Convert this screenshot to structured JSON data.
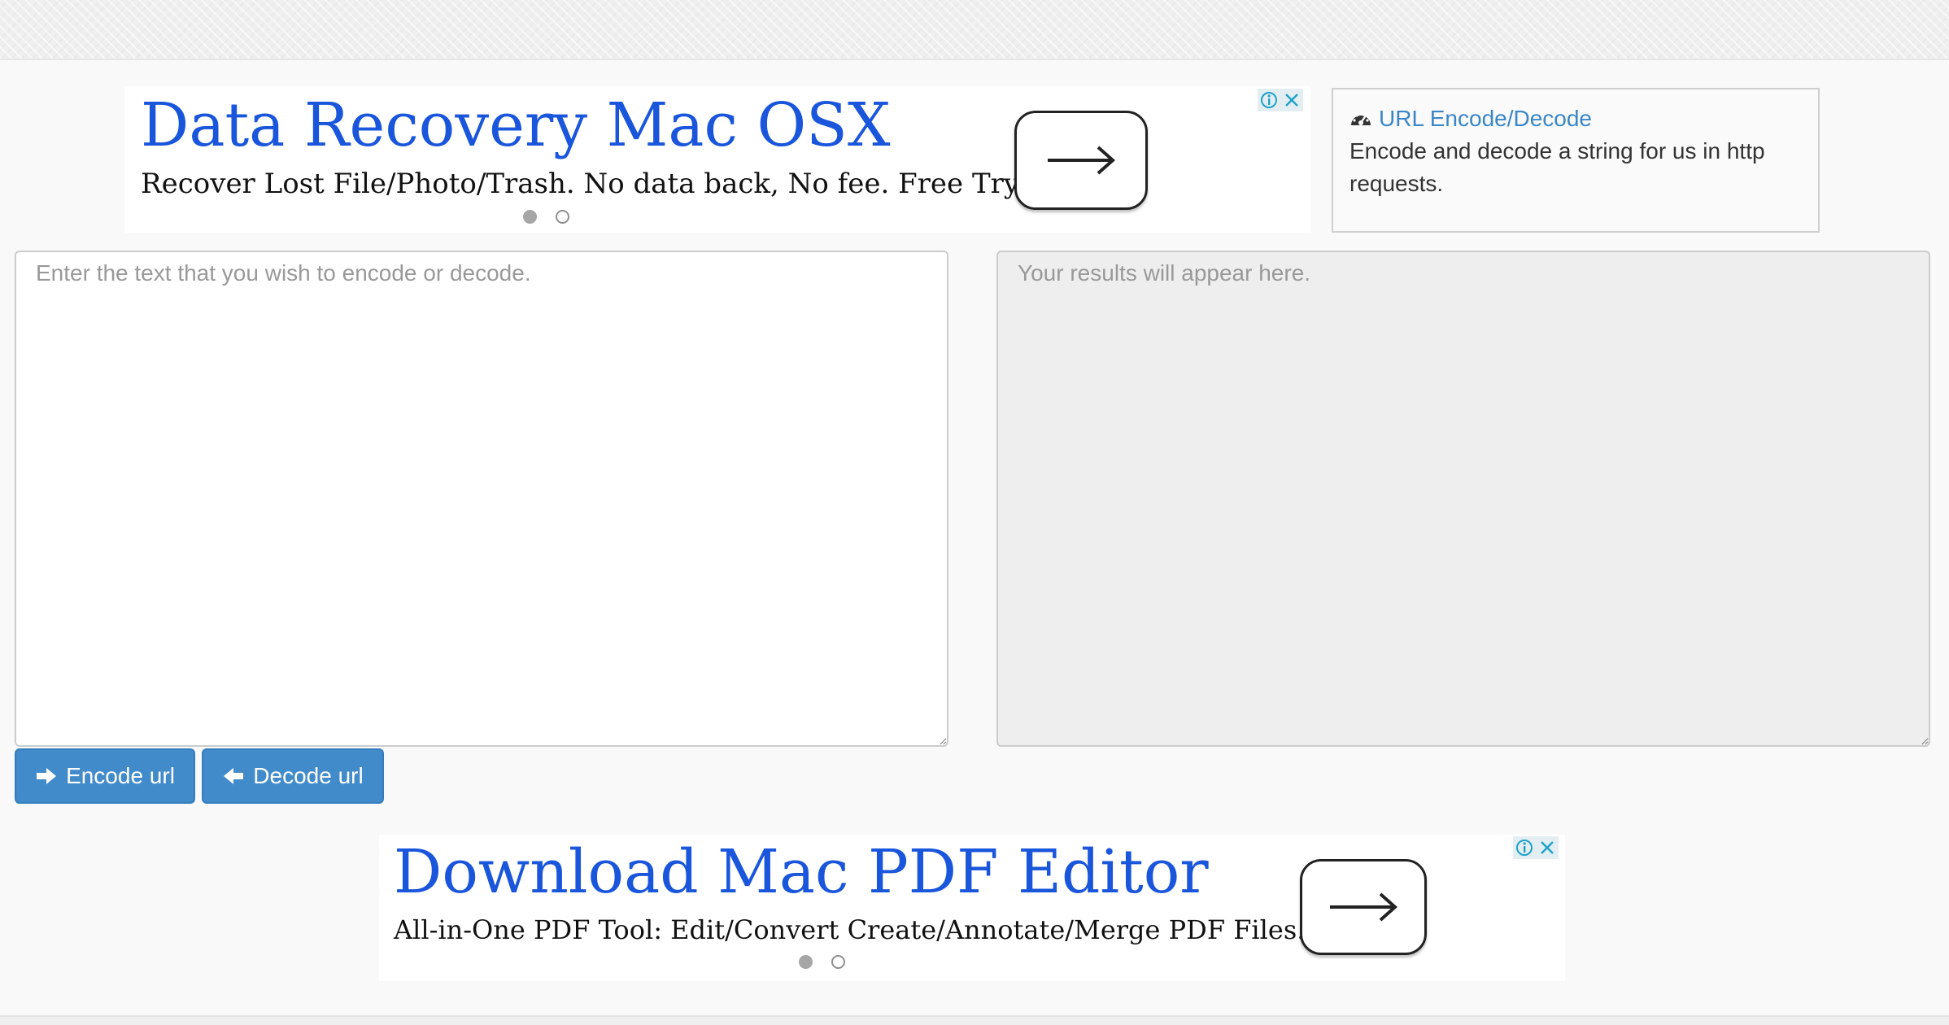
{
  "ad_top": {
    "title": "Data Recovery Mac OSX",
    "description": "Recover Lost File/Photo/Trash. No data back, No fee. Free Try!",
    "arrow_icon": "arrow-right-icon",
    "carousel_active": 1,
    "carousel_count": 2
  },
  "ad_bottom": {
    "title": "Download Mac PDF Editor",
    "description": "All-in-One PDF Tool: Edit/Convert Create/Annotate/Merge PDF Files.",
    "arrow_icon": "arrow-right-icon",
    "carousel_active": 1,
    "carousel_count": 2
  },
  "info_box": {
    "icon": "dashboard-icon",
    "title": "URL Encode/Decode",
    "description": "Encode and decode a string for us in http requests."
  },
  "input": {
    "placeholder": "Enter the text that you wish to encode or decode.",
    "value": ""
  },
  "output": {
    "placeholder": "Your results will appear here.",
    "value": ""
  },
  "buttons": {
    "encode_label": "Encode url",
    "encode_icon": "arrow-right-icon",
    "decode_label": "Decode url",
    "decode_icon": "arrow-left-icon"
  },
  "colors": {
    "ad_title": "#1a56db",
    "button_primary": "#428bca",
    "link": "#3a86c8",
    "adchoices_icon": "#1fa1c8"
  }
}
